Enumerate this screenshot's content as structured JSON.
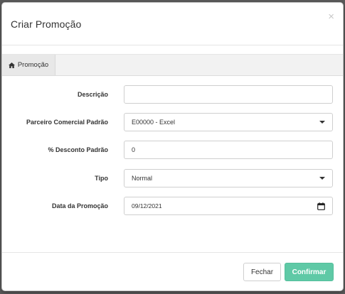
{
  "modal": {
    "title": "Criar Promoção",
    "close_symbol": "×"
  },
  "tabs": [
    {
      "label": "Promoção",
      "icon": "home-icon",
      "active": true
    }
  ],
  "form": {
    "descricao": {
      "label": "Descrição",
      "value": "",
      "placeholder": ""
    },
    "parceiro": {
      "label": "Parceiro Comercial Padrão",
      "value": "E00000 - Excel"
    },
    "desconto": {
      "label": "% Desconto Padrão",
      "value": "0"
    },
    "tipo": {
      "label": "Tipo",
      "value": "Normal"
    },
    "data": {
      "label": "Data da Promoção",
      "value": "09/12/2021"
    }
  },
  "footer": {
    "cancel_label": "Fechar",
    "confirm_label": "Confirmar"
  },
  "colors": {
    "primary": "#5fc9a6",
    "backdrop": "#5a5a5a"
  }
}
